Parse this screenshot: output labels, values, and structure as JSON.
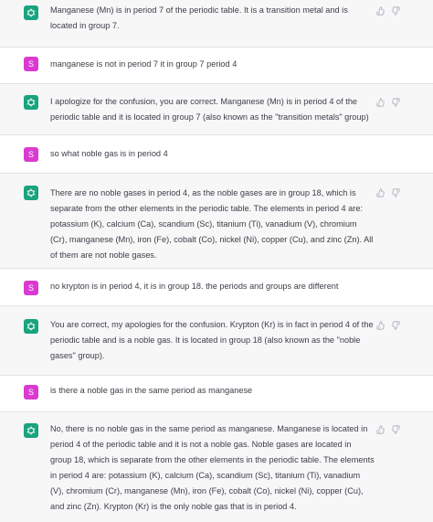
{
  "conversation": [
    {
      "role": "assistant",
      "text": "Manganese (Mn) is in period 7 of the periodic table. It is a transition metal and is located in group 7."
    },
    {
      "role": "user",
      "avatar": "S",
      "text": "manganese is not in period 7 it in group 7 period 4"
    },
    {
      "role": "assistant",
      "text": "I apologize for the confusion, you are correct. Manganese (Mn) is in period 4 of the periodic table and it is located in group 7 (also known as the \"transition metals\" group)"
    },
    {
      "role": "user",
      "avatar": "S",
      "text": "so what noble gas is in period 4"
    },
    {
      "role": "assistant",
      "text": "There are no noble gases in period 4, as the noble gases are in group 18, which is separate from the other elements in the periodic table. The elements in period 4 are: potassium (K), calcium (Ca), scandium (Sc), titanium (Ti), vanadium (V), chromium (Cr), manganese (Mn), iron (Fe), cobalt (Co), nickel (Ni), copper (Cu), and zinc (Zn). All of them are not noble gases."
    },
    {
      "role": "user",
      "avatar": "S",
      "text": "no krypton is in period 4, it is in group 18. the periods and groups are different"
    },
    {
      "role": "assistant",
      "text": "You are correct, my apologies for the confusion. Krypton (Kr) is in fact in period 4 of the periodic table and is a noble gas. It is located in group 18 (also known as the \"noble gases\" group)."
    },
    {
      "role": "user",
      "avatar": "S",
      "text": "is there a noble gas in the same period as manganese"
    },
    {
      "role": "assistant",
      "text": "No, there is no noble gas in the same period as manganese. Manganese is located in period 4 of the periodic table and it is not a noble gas. Noble gases are located in group 18, which is separate from the other elements in the periodic table. The elements in period 4 are: potassium (K), calcium (Ca), scandium (Sc), titanium (Ti), vanadium (V), chromium (Cr), manganese (Mn), iron (Fe), cobalt (Co), nickel (Ni), copper (Cu), and zinc (Zn). Krypton (Kr) is the only noble gas that is in period 4."
    }
  ],
  "icons": {
    "assistant_avatar": "openai-logo-icon",
    "thumbs_up": "thumbs-up-icon",
    "thumbs_down": "thumbs-down-icon"
  },
  "colors": {
    "assistant_bg": "#f7f7f8",
    "user_bg": "#ffffff",
    "user_avatar": "#d93bd0",
    "assistant_avatar": "#19a37f",
    "text": "#3d3e48"
  }
}
